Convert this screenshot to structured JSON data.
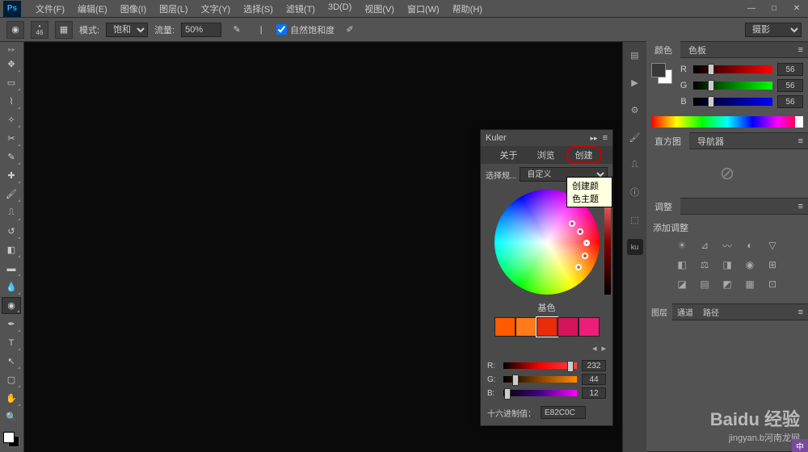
{
  "app": {
    "logo": "Ps"
  },
  "menu": [
    "文件(F)",
    "编辑(E)",
    "图像(I)",
    "图层(L)",
    "文字(Y)",
    "选择(S)",
    "滤镜(T)",
    "3D(D)",
    "视图(V)",
    "窗口(W)",
    "帮助(H)"
  ],
  "window_controls": {
    "min": "—",
    "max": "□",
    "close": "✕"
  },
  "options": {
    "brush_size": "46",
    "mode_label": "模式:",
    "mode_value": "饱和",
    "flow_label": "流量:",
    "flow_value": "50%",
    "vibrance_label": "自然饱和度",
    "right_dropdown": "摄影"
  },
  "tools": [
    "move",
    "marquee",
    "lasso",
    "wand",
    "crop",
    "eyedropper",
    "heal",
    "brush",
    "stamp",
    "history",
    "eraser",
    "gradient",
    "blur",
    "sponge",
    "pen",
    "type",
    "path",
    "shape",
    "hand",
    "zoom"
  ],
  "color_panel": {
    "tabs": [
      "颜色",
      "色板"
    ],
    "r_label": "R",
    "g_label": "G",
    "b_label": "B",
    "r": "56",
    "g": "56",
    "b": "56"
  },
  "histogram": {
    "tabs": [
      "直方图",
      "导航器"
    ],
    "empty": "⊘"
  },
  "adjust": {
    "tabs": [
      "调整"
    ],
    "title": "添加调整"
  },
  "layers": {
    "tabs": [
      "图层",
      "通道",
      "路径"
    ]
  },
  "kuler": {
    "title": "Kuler",
    "collapse": "▸▸",
    "menu": "≡",
    "tabs": [
      "关于",
      "浏览",
      "创建"
    ],
    "active_tab": 2,
    "rule_label": "选择规...",
    "rule_value": "自定义",
    "tooltip": "创建颜色主题",
    "base_label": "基色",
    "swatches": [
      "#ff5a00",
      "#ff7a1a",
      "#e82c0c",
      "#d4145a",
      "#ed1e79"
    ],
    "r_label": "R:",
    "r_val": "232",
    "g_label": "G:",
    "g_val": "44",
    "b_label": "B:",
    "b_val": "12",
    "hex_label": "十六进制值：",
    "hex_value": "E82C0C"
  },
  "watermark": {
    "main": "Baidu 经验",
    "sub": "jingyan.b河南龙网"
  },
  "badge": "中"
}
